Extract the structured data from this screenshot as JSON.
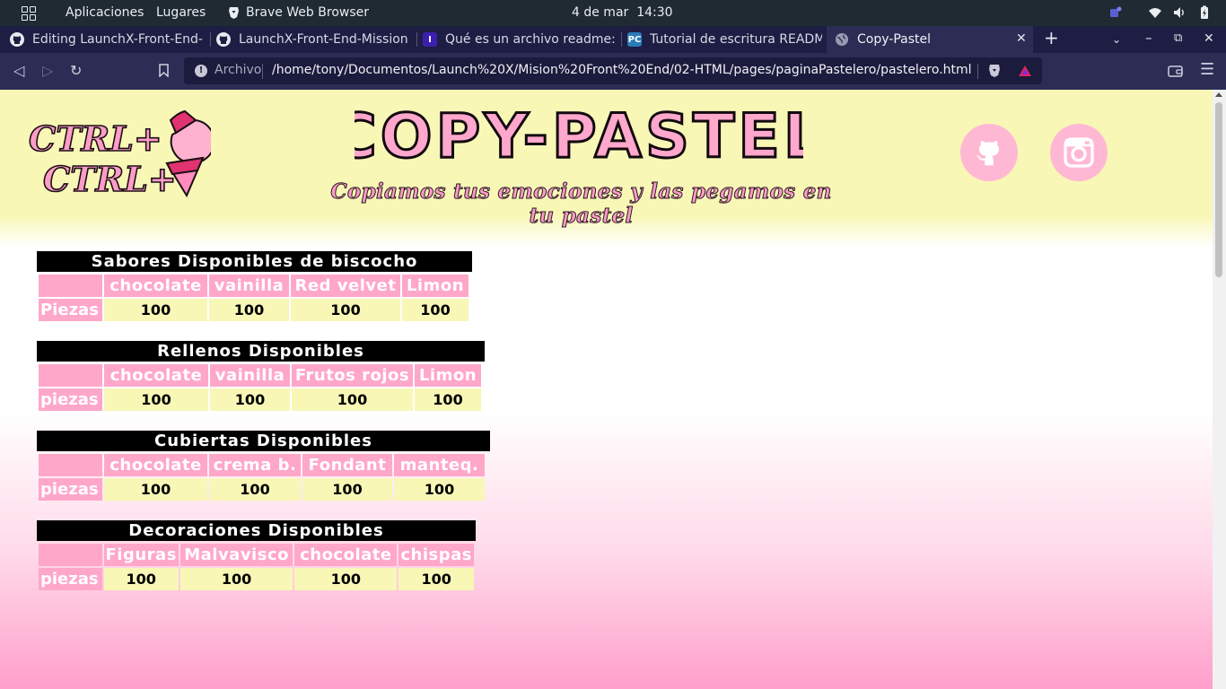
{
  "desktop": {
    "activities_label": "Aplicaciones",
    "places_label": "Lugares",
    "app_label": "Brave Web Browser",
    "date": "4 de mar",
    "time": "14:30"
  },
  "browser": {
    "tabs": [
      {
        "label": "Editing LaunchX-Front-End-",
        "icon": "github-icon",
        "active": false
      },
      {
        "label": "LaunchX-Front-End-Mission",
        "icon": "github-icon",
        "active": false
      },
      {
        "label": "Qué es un archivo readme: ex",
        "icon": "site-icon",
        "active": false
      },
      {
        "label": "Tutorial de escritura README",
        "icon": "pc-icon",
        "active": false
      },
      {
        "label": "Copy-Pastel",
        "icon": "globe-icon",
        "active": true
      }
    ],
    "url_scheme": "Archivo",
    "url": "/home/tony/Documentos/Launch%20X/Mision%20Front%20End/02-HTML/pages/paginaPastelero/pastelero.html"
  },
  "page": {
    "logo_lines": [
      "CTRL+",
      "CTRL+"
    ],
    "brand": "COPY-PASTEL",
    "tagline": "Copiamos tus emociones y las pegamos en tu pastel",
    "tables": [
      {
        "caption": "Sabores Disponibles de biscocho",
        "headers": [
          "",
          "chocolate",
          "vainilla",
          "Red velvet",
          "Limon"
        ],
        "row_label": "Piezas",
        "values": [
          "100",
          "100",
          "100",
          "100"
        ]
      },
      {
        "caption": "Rellenos Disponibles",
        "headers": [
          "",
          "chocolate",
          "vainilla",
          "Frutos rojos",
          "Limon"
        ],
        "row_label": "piezas",
        "values": [
          "100",
          "100",
          "100",
          "100"
        ]
      },
      {
        "caption": "Cubiertas Disponibles",
        "headers": [
          "",
          "chocolate",
          "crema b.",
          "Fondant",
          "manteq."
        ],
        "row_label": "piezas",
        "values": [
          "100",
          "100",
          "100",
          "100"
        ]
      },
      {
        "caption": "Decoraciones Disponibles",
        "headers": [
          "",
          "Figuras",
          "Malvavisco",
          "chocolate",
          "chispas"
        ],
        "row_label": "piezas",
        "values": [
          "100",
          "100",
          "100",
          "100"
        ]
      }
    ]
  },
  "colors": {
    "header_bg": "#f8f7b6",
    "accent_pink": "#ffa7c9",
    "caption_bg": "#000000"
  }
}
